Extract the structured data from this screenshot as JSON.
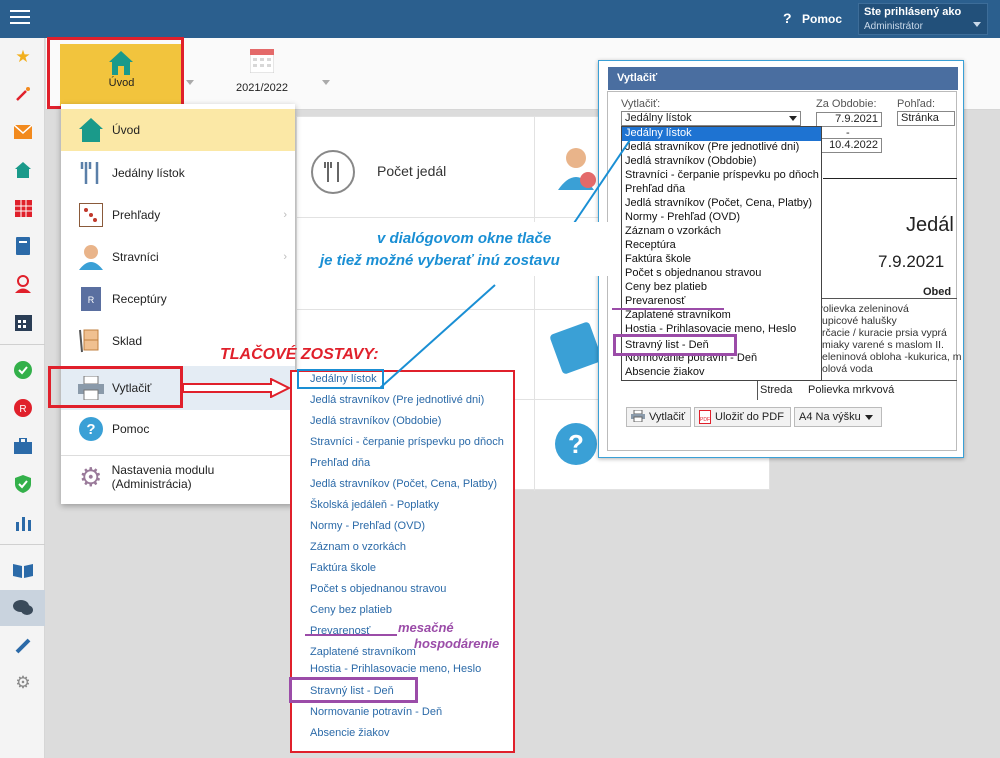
{
  "topbar": {
    "help_label": "Pomoc",
    "help_glyph": "?",
    "user_title": "Ste prihlásený ako",
    "user_role": "Administrátor"
  },
  "rail": {
    "icons": [
      "star-icon",
      "magic-wand-icon",
      "mail-icon",
      "home-icon",
      "calendar-grid-icon",
      "book-icon",
      "user-icon",
      "calendar-icon",
      "check-circle-icon",
      "food-circle-icon",
      "briefcase-icon",
      "shield-icon",
      "chart-icon",
      "open-book-icon",
      "chat-icon",
      "pen-icon",
      "gear-icon"
    ]
  },
  "tabs": {
    "home_label": "Úvod",
    "year_label": "2021/2022"
  },
  "content": {
    "tile_pocet": "Počet jedál"
  },
  "menu": {
    "items": [
      {
        "label": "Úvod",
        "icon": "home-icon"
      },
      {
        "label": "Jedálny lístok",
        "icon": "cutlery-icon"
      },
      {
        "label": "Prehľady",
        "icon": "abacus-icon"
      },
      {
        "label": "Stravníci",
        "icon": "person-icon"
      },
      {
        "label": "Receptúry",
        "icon": "recipe-book-icon"
      },
      {
        "label": "Sklad",
        "icon": "warehouse-cart-icon"
      },
      {
        "label": "Vytlačiť",
        "icon": "printer-icon"
      },
      {
        "label": "Pomoc",
        "icon": "help-icon"
      },
      {
        "label": "Nastavenia modulu (Administrácia)",
        "icon": "settings-gear-icon"
      }
    ]
  },
  "print_list": {
    "heading": "TLAČOVÉ ZOSTAVY:",
    "items": [
      "Jedálny lístok",
      "Jedlá stravníkov (Pre jednotlivé dni)",
      "Jedlá stravníkov (Obdobie)",
      "Stravníci - čerpanie príspevku po dňoch",
      "Prehľad dňa",
      "Jedlá stravníkov (Počet, Cena, Platby)",
      "Školská jedáleň - Poplatky",
      "Normy - Prehľad (OVD)",
      "Záznam o vzorkách",
      "Faktúra škole",
      "Počet s objednanou stravou",
      "Ceny bez platieb",
      "Prevarenosť",
      "Zaplatené stravníkom",
      "Hostia - Prihlasovacie meno, Heslo",
      "Stravný list - Deň",
      "Normovanie potravín - Deň",
      "Absencie žiakov"
    ]
  },
  "annotations": {
    "dialog_line1": "v dialógovom okne tlače",
    "dialog_line2": "je tiež možné vyberať inú zostavu",
    "monthly_line1": "mesačné",
    "monthly_line2": "hospodárenie"
  },
  "dialog": {
    "title": "Vytlačiť",
    "print_label": "Vytlačiť:",
    "selected": "Jedálny lístok",
    "period_label": "Za Obdobie:",
    "date_from": "7.9.2021",
    "dash": "-",
    "date_to": "10.4.2022",
    "view_label": "Pohľad:",
    "view_value": "Stránka pre",
    "dropdown_items": [
      "Jedálny lístok",
      "Jedlá stravníkov (Pre jednotlivé dni)",
      "Jedlá stravníkov (Obdobie)",
      "Stravníci - čerpanie príspevku po dňoch",
      "Prehľad dňa",
      "Jedlá stravníkov (Počet, Cena, Platby)",
      "Normy - Prehľad (OVD)",
      "Záznam o vzorkách",
      "Receptúra",
      "Faktúra škole",
      "Počet s objednanou stravou",
      "Ceny bez platieb",
      "Prevarenosť",
      "Zaplatené stravníkom",
      "Hostia - Prihlasovacie meno, Heslo",
      "Stravný list - Deň",
      "Normovanie potravín - Deň",
      "Absencie žiakov"
    ],
    "preview_title": "Jedál",
    "preview_date": "7.9.2021",
    "preview_obed": "Obed",
    "preview_lines": [
      "Polievka zeleninová",
      "upicové halušky",
      "rčacie / kuracie prsia vyprá",
      "miaky varené s maslom II.",
      "eleninová obloha -kukurica, m",
      "olová voda"
    ],
    "preview_day": "Streda",
    "preview_soup": "Polievka mrkvová",
    "btn_print": "Vytlačiť",
    "btn_pdf": "Uložiť do PDF",
    "btn_paper": "A4 Na výšku",
    "pdf_badge": "PDF"
  },
  "colors": {
    "topbar": "#2b5f8e",
    "accent_tab": "#f2c43d",
    "red_highlight": "#e0202b",
    "purple_highlight": "#9b4ca8",
    "annotation_blue": "#1a8fd4",
    "link_blue": "#2b6aa8",
    "dropdown_selected": "#1e73d2"
  }
}
